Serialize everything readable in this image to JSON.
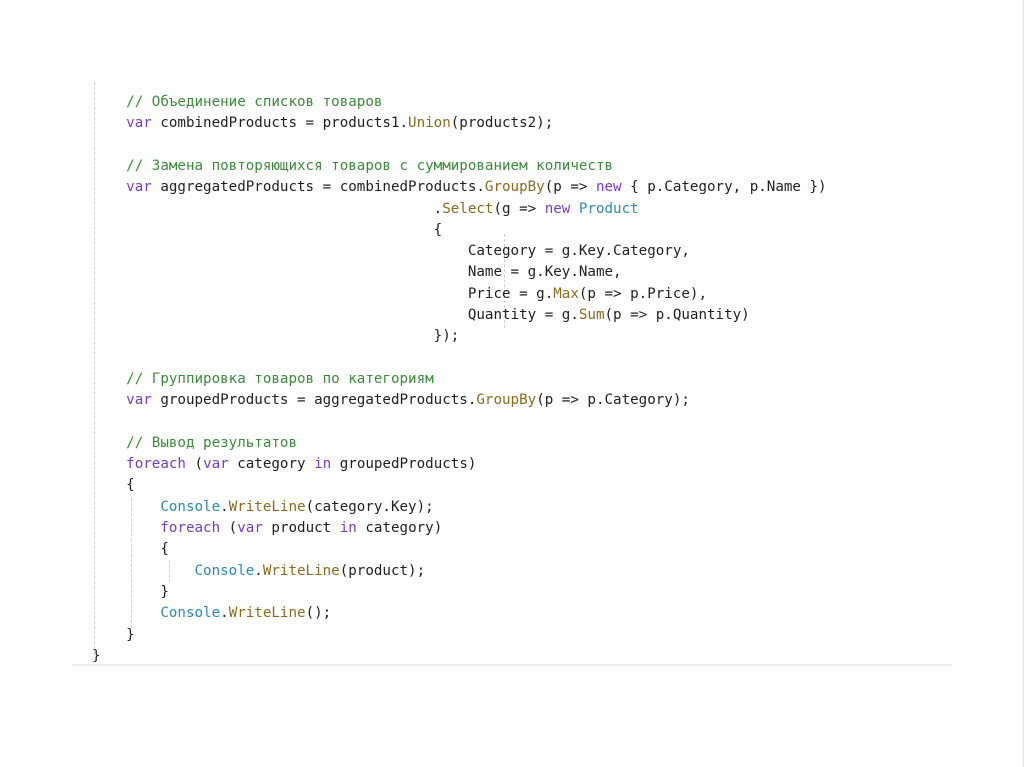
{
  "colors": {
    "comment": "#3c8b3c",
    "keyword": "#7a3cc6",
    "identifier": "#1f1f1f",
    "method": "#8a6a1e",
    "type": "#2b8bb1",
    "background": "#ffffff"
  },
  "code": {
    "lines": [
      {
        "indent": "    ",
        "tokens": [
          {
            "t": "// Объединение списков товаров",
            "k": "comment"
          }
        ]
      },
      {
        "indent": "    ",
        "tokens": [
          {
            "t": "var",
            "k": "keyword"
          },
          {
            "t": " combinedProducts = products1.",
            "k": "ident"
          },
          {
            "t": "Union",
            "k": "method"
          },
          {
            "t": "(products2);",
            "k": "ident"
          }
        ]
      },
      {
        "indent": "",
        "tokens": []
      },
      {
        "indent": "    ",
        "tokens": [
          {
            "t": "// Замена повторяющихся товаров с суммированием количеств",
            "k": "comment"
          }
        ]
      },
      {
        "indent": "    ",
        "tokens": [
          {
            "t": "var",
            "k": "keyword"
          },
          {
            "t": " aggregatedProducts = combinedProducts.",
            "k": "ident"
          },
          {
            "t": "GroupBy",
            "k": "method"
          },
          {
            "t": "(p => ",
            "k": "ident"
          },
          {
            "t": "new",
            "k": "keyword"
          },
          {
            "t": " { p.Category, p.Name })",
            "k": "ident"
          }
        ]
      },
      {
        "indent": "                                        ",
        "tokens": [
          {
            "t": ".",
            "k": "ident"
          },
          {
            "t": "Select",
            "k": "method"
          },
          {
            "t": "(g => ",
            "k": "ident"
          },
          {
            "t": "new",
            "k": "keyword"
          },
          {
            "t": " ",
            "k": "ident"
          },
          {
            "t": "Product",
            "k": "type"
          }
        ]
      },
      {
        "indent": "                                        ",
        "tokens": [
          {
            "t": "{",
            "k": "ident"
          }
        ]
      },
      {
        "indent": "                                            ",
        "tokens": [
          {
            "t": "Category = g.Key.Category,",
            "k": "ident"
          }
        ]
      },
      {
        "indent": "                                            ",
        "tokens": [
          {
            "t": "Name = g.Key.Name,",
            "k": "ident"
          }
        ]
      },
      {
        "indent": "                                            ",
        "tokens": [
          {
            "t": "Price = g.",
            "k": "ident"
          },
          {
            "t": "Max",
            "k": "method"
          },
          {
            "t": "(p => p.Price),",
            "k": "ident"
          }
        ]
      },
      {
        "indent": "                                            ",
        "tokens": [
          {
            "t": "Quantity = g.",
            "k": "ident"
          },
          {
            "t": "Sum",
            "k": "method"
          },
          {
            "t": "(p => p.Quantity)",
            "k": "ident"
          }
        ]
      },
      {
        "indent": "                                        ",
        "tokens": [
          {
            "t": "});",
            "k": "ident"
          }
        ]
      },
      {
        "indent": "",
        "tokens": []
      },
      {
        "indent": "    ",
        "tokens": [
          {
            "t": "// Группировка товаров по категориям",
            "k": "comment"
          }
        ]
      },
      {
        "indent": "    ",
        "tokens": [
          {
            "t": "var",
            "k": "keyword"
          },
          {
            "t": " groupedProducts = aggregatedProducts.",
            "k": "ident"
          },
          {
            "t": "GroupBy",
            "k": "method"
          },
          {
            "t": "(p => p.Category);",
            "k": "ident"
          }
        ]
      },
      {
        "indent": "",
        "tokens": []
      },
      {
        "indent": "    ",
        "tokens": [
          {
            "t": "// Вывод результатов",
            "k": "comment"
          }
        ]
      },
      {
        "indent": "    ",
        "tokens": [
          {
            "t": "foreach",
            "k": "keyword"
          },
          {
            "t": " (",
            "k": "ident"
          },
          {
            "t": "var",
            "k": "keyword"
          },
          {
            "t": " category ",
            "k": "ident"
          },
          {
            "t": "in",
            "k": "keyword"
          },
          {
            "t": " groupedProducts)",
            "k": "ident"
          }
        ]
      },
      {
        "indent": "    ",
        "tokens": [
          {
            "t": "{",
            "k": "ident"
          }
        ]
      },
      {
        "indent": "        ",
        "tokens": [
          {
            "t": "Console",
            "k": "type"
          },
          {
            "t": ".",
            "k": "ident"
          },
          {
            "t": "WriteLine",
            "k": "method"
          },
          {
            "t": "(category.Key);",
            "k": "ident"
          }
        ]
      },
      {
        "indent": "        ",
        "tokens": [
          {
            "t": "foreach",
            "k": "keyword"
          },
          {
            "t": " (",
            "k": "ident"
          },
          {
            "t": "var",
            "k": "keyword"
          },
          {
            "t": " product ",
            "k": "ident"
          },
          {
            "t": "in",
            "k": "keyword"
          },
          {
            "t": " category)",
            "k": "ident"
          }
        ]
      },
      {
        "indent": "        ",
        "tokens": [
          {
            "t": "{",
            "k": "ident"
          }
        ]
      },
      {
        "indent": "            ",
        "tokens": [
          {
            "t": "Console",
            "k": "type"
          },
          {
            "t": ".",
            "k": "ident"
          },
          {
            "t": "WriteLine",
            "k": "method"
          },
          {
            "t": "(product);",
            "k": "ident"
          }
        ]
      },
      {
        "indent": "        ",
        "tokens": [
          {
            "t": "}",
            "k": "ident"
          }
        ]
      },
      {
        "indent": "        ",
        "tokens": [
          {
            "t": "Console",
            "k": "type"
          },
          {
            "t": ".",
            "k": "ident"
          },
          {
            "t": "WriteLine",
            "k": "method"
          },
          {
            "t": "();",
            "k": "ident"
          }
        ]
      },
      {
        "indent": "    ",
        "tokens": [
          {
            "t": "}",
            "k": "ident"
          }
        ]
      },
      {
        "indent": "",
        "tokens": [
          {
            "t": "}",
            "k": "ident"
          }
        ]
      }
    ]
  }
}
